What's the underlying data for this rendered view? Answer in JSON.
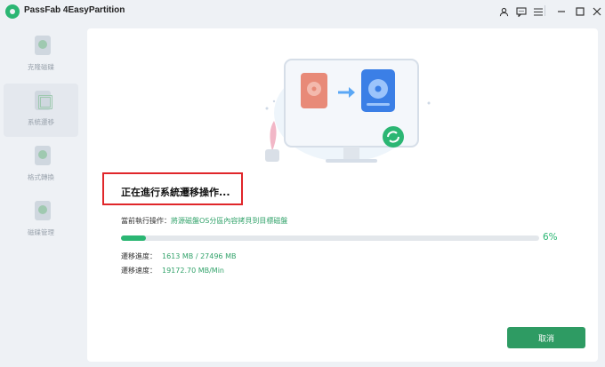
{
  "app": {
    "title": "PassFab 4EasyPartition"
  },
  "sidebar": {
    "items": [
      {
        "label": "克隆磁碟",
        "icon": "disk-clone-icon",
        "active": false
      },
      {
        "label": "系統遷移",
        "icon": "system-migrate-icon",
        "active": true
      },
      {
        "label": "格式轉換",
        "icon": "format-convert-icon",
        "active": false
      },
      {
        "label": "磁碟管理",
        "icon": "disk-manage-icon",
        "active": false
      }
    ]
  },
  "main": {
    "status_title": "正在進行系統遷移操作...",
    "current_op_label": "當前執行操作：",
    "current_op_value": "將源磁盤OS分區內容拷貝到目標磁盤",
    "progress": {
      "percent": 6,
      "label": "6%"
    },
    "migrated_label": "遷移進度：",
    "migrated_value": "1613 MB /  27496 MB",
    "speed_label": "遷移速度：",
    "speed_value": "19172.70 MB/Min",
    "cancel_label": "取消"
  },
  "colors": {
    "accent": "#2bb673",
    "button": "#2e9b63",
    "highlight": "#e0262a"
  }
}
